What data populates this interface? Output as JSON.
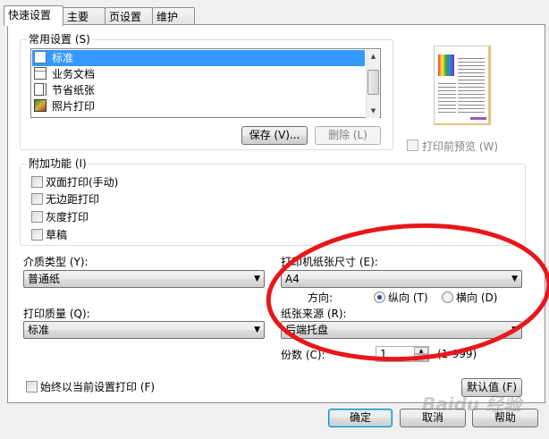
{
  "tabs": [
    "快速设置",
    "主要",
    "页设置",
    "维护"
  ],
  "common_settings": {
    "label": "常用设置 (S)",
    "items": [
      "标准",
      "业务文档",
      "节省纸张",
      "照片打印"
    ],
    "save_button": "保存 (V)...",
    "delete_button": "删除 (L)"
  },
  "preview_checkbox": "打印前预览 (W)",
  "additional": {
    "label": "附加功能 (I)",
    "items": [
      "双面打印(手动)",
      "无边距打印",
      "灰度打印",
      "草稿"
    ]
  },
  "media_type": {
    "label": "介质类型 (Y):",
    "value": "普通纸"
  },
  "paper_size": {
    "label": "打印机纸张尺寸 (E):",
    "value": "A4"
  },
  "orientation": {
    "label": "方向:",
    "portrait": "纵向 (T)",
    "landscape": "横向 (D)"
  },
  "print_quality": {
    "label": "打印质量 (Q):",
    "value": "标准"
  },
  "paper_source": {
    "label": "纸张来源 (R):",
    "value": "后端托盘"
  },
  "copies": {
    "label": "份数 (C):",
    "value": "1",
    "range": "(1-999)"
  },
  "always_print_checkbox": "始终以当前设置打印 (F)",
  "defaults_button": "默认值 (F)",
  "dialog_buttons": {
    "ok": "确定",
    "cancel": "取消",
    "help": "帮助"
  },
  "watermark_text": "Baidu 经验",
  "colors": {
    "selection": "#3399ff",
    "annotation_circle": "#e8171a"
  }
}
